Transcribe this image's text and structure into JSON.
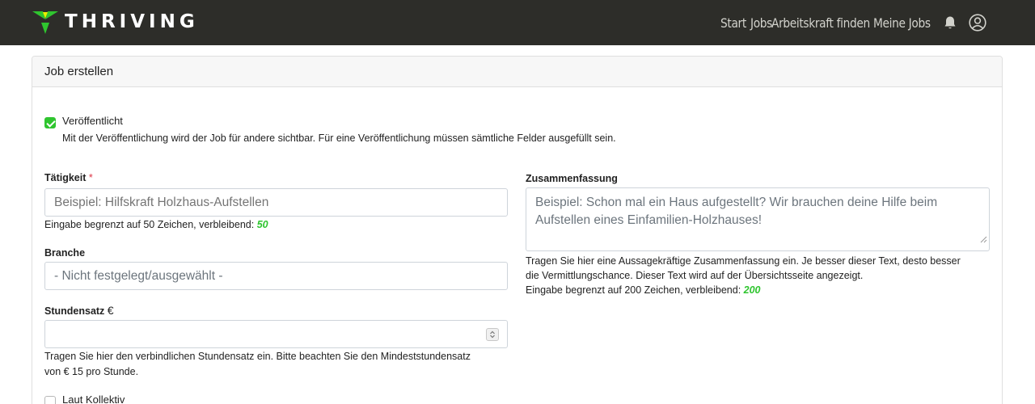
{
  "brand": {
    "name": "THRIVING"
  },
  "nav": {
    "links": [
      "Start",
      "Jobs",
      "Arbeitskraft finden",
      "Meine Jobs"
    ],
    "icons": [
      "bell-icon",
      "user-circle-icon"
    ]
  },
  "card": {
    "title": "Job erstellen"
  },
  "published": {
    "checked": true,
    "label": "Veröffentlicht",
    "help": "Mit der Veröffentlichung wird der Job für andere sichtbar. Für eine Veröffentlichung müssen sämtliche Felder ausgefüllt sein."
  },
  "taetigkeit": {
    "label": "Tätigkeit",
    "required_mark": "*",
    "placeholder": "Beispiel: Hilfskraft Holzhaus-Aufstellen",
    "help_prefix": "Eingabe begrenzt auf 50 Zeichen, verbleibend:",
    "remaining": "50"
  },
  "branche": {
    "label": "Branche",
    "selected": "- Nicht festgelegt/ausgewählt -"
  },
  "stundensatz": {
    "label": "Stundensatz",
    "currency": "€",
    "value": "",
    "help_line1": "Tragen Sie hier den verbindlichen Stundensatz ein. Bitte beachten Sie den Mindeststundensatz",
    "help_line2": "von € 15 pro Stunde."
  },
  "kollektiv": {
    "checked": false,
    "label": "Laut Kollektiv"
  },
  "zusammenfassung": {
    "label": "Zusammenfassung",
    "placeholder": "Beispiel: Schon mal ein Haus aufgestellt? Wir brauchen deine Hilfe beim Aufstellen eines Einfamilien-Holzhauses!",
    "help_line1": "Tragen Sie hier eine Aussagekräftige Zusammenfassung ein. Je besser dieser Text, desto besser",
    "help_line2": "die Vermittlungschance. Dieser Text wird auf der Übersichtsseite angezeigt.",
    "limit_prefix": "Eingabe begrenzt auf 200 Zeichen, verbleibend:",
    "remaining": "200"
  },
  "colors": {
    "navbar": "#2d2d29",
    "accent_green": "#2fc52f",
    "required_red": "#dc3545"
  }
}
